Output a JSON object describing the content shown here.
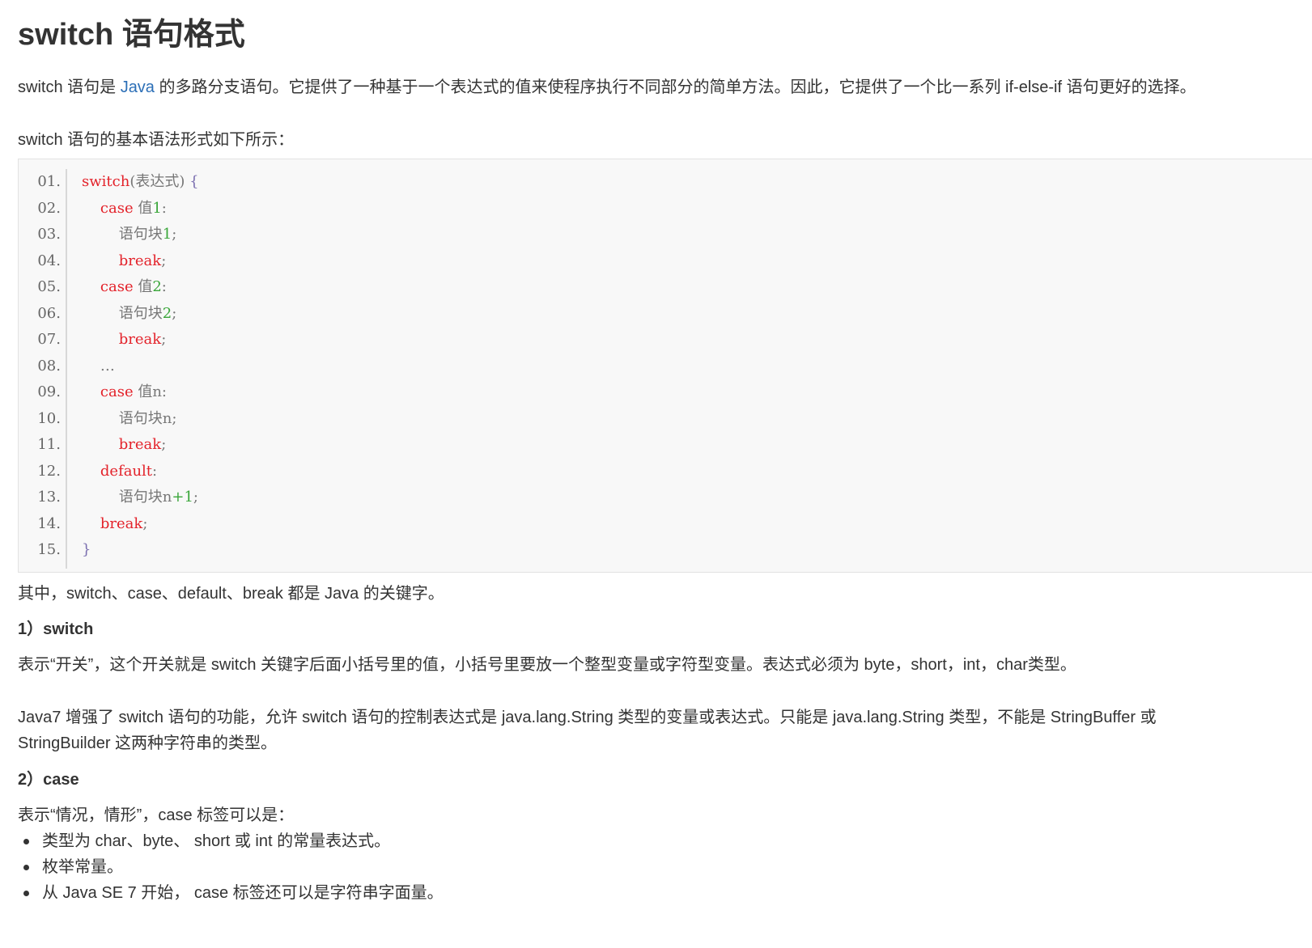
{
  "article": {
    "title": "switch 语句格式",
    "intro": {
      "before_link": "switch 语句是 ",
      "link_text": "Java",
      "after_link": " 的多路分支语句。它提供了一种基于一个表达式的值来使程序执行不同部分的简单方法。因此，它提供了一个比一系列 if-else-if 语句更好的选择。"
    },
    "syntax_intro": "switch 语句的基本语法形式如下所示：",
    "code": {
      "line_numbers": [
        "01.",
        "02.",
        "03.",
        "04.",
        "05.",
        "06.",
        "07.",
        "08.",
        "09.",
        "10.",
        "11.",
        "12.",
        "13.",
        "14.",
        "15."
      ],
      "lines": [
        [
          {
            "t": "switch",
            "c": "kw"
          },
          {
            "t": "(表达式) ",
            "c": "plain"
          },
          {
            "t": "{",
            "c": "brace"
          }
        ],
        [
          {
            "t": "    ",
            "c": "plain"
          },
          {
            "t": "case",
            "c": "kw"
          },
          {
            "t": " 值",
            "c": "plain"
          },
          {
            "t": "1",
            "c": "num"
          },
          {
            "t": ":",
            "c": "plain"
          }
        ],
        [
          {
            "t": "        语句块",
            "c": "plain"
          },
          {
            "t": "1",
            "c": "num"
          },
          {
            "t": ";",
            "c": "plain"
          }
        ],
        [
          {
            "t": "        ",
            "c": "plain"
          },
          {
            "t": "break",
            "c": "kw"
          },
          {
            "t": ";",
            "c": "plain"
          }
        ],
        [
          {
            "t": "    ",
            "c": "plain"
          },
          {
            "t": "case",
            "c": "kw"
          },
          {
            "t": " 值",
            "c": "plain"
          },
          {
            "t": "2",
            "c": "num"
          },
          {
            "t": ":",
            "c": "plain"
          }
        ],
        [
          {
            "t": "        语句块",
            "c": "plain"
          },
          {
            "t": "2",
            "c": "num"
          },
          {
            "t": ";",
            "c": "plain"
          }
        ],
        [
          {
            "t": "        ",
            "c": "plain"
          },
          {
            "t": "break",
            "c": "kw"
          },
          {
            "t": ";",
            "c": "plain"
          }
        ],
        [
          {
            "t": "    …",
            "c": "plain"
          }
        ],
        [
          {
            "t": "    ",
            "c": "plain"
          },
          {
            "t": "case",
            "c": "kw"
          },
          {
            "t": " 值n:",
            "c": "plain"
          }
        ],
        [
          {
            "t": "        语句块n;",
            "c": "plain"
          }
        ],
        [
          {
            "t": "        ",
            "c": "plain"
          },
          {
            "t": "break",
            "c": "kw"
          },
          {
            "t": ";",
            "c": "plain"
          }
        ],
        [
          {
            "t": "    ",
            "c": "plain"
          },
          {
            "t": "default",
            "c": "kw"
          },
          {
            "t": ":",
            "c": "plain"
          }
        ],
        [
          {
            "t": "        语句块n",
            "c": "plain"
          },
          {
            "t": "+1",
            "c": "num"
          },
          {
            "t": ";",
            "c": "plain"
          }
        ],
        [
          {
            "t": "    ",
            "c": "plain"
          },
          {
            "t": "break",
            "c": "kw"
          },
          {
            "t": ";",
            "c": "plain"
          }
        ],
        [
          {
            "t": "}",
            "c": "brace"
          }
        ]
      ]
    },
    "keywords_note": "其中，switch、case、default、break 都是 Java 的关键字。",
    "section1": {
      "heading": "1）switch",
      "p1": "表示“开关”，这个开关就是 switch 关键字后面小括号里的值，小括号里要放一个整型变量或字符型变量。表达式必须为 byte，short，int，char类型。",
      "p2_line1": "Java7 增强了 switch 语句的功能，允许 switch 语句的控制表达式是 java.lang.String 类型的变量或表达式。只能是 java.lang.String 类型，不能是 StringBuffer 或",
      "p2_line2": "StringBuilder 这两种字符串的类型。"
    },
    "section2": {
      "heading": "2）case",
      "p1": "表示“情况，情形”，case 标签可以是：",
      "bullets": [
        "类型为 char、byte、 short 或 int 的常量表达式。",
        "枚举常量。",
        "从 Java SE 7 开始， case 标签还可以是字符串字面量。"
      ]
    }
  }
}
